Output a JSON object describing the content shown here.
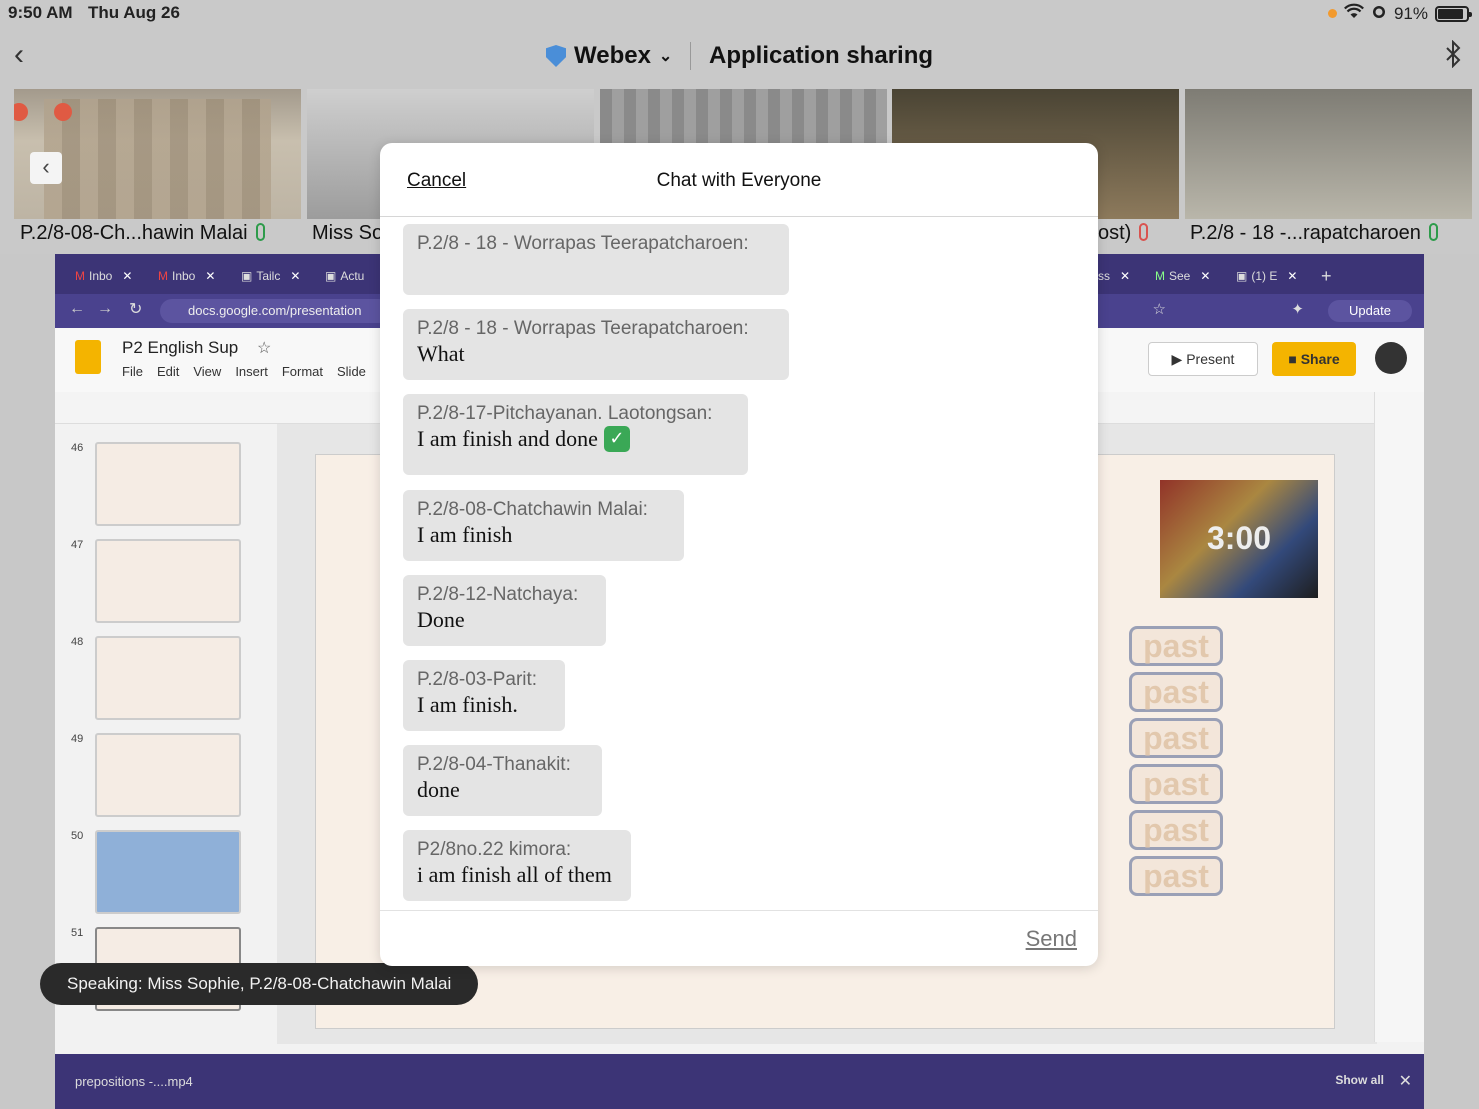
{
  "status_bar": {
    "time": "9:50 AM",
    "date": "Thu Aug 26",
    "battery": "91%",
    "battery_level": 0.91,
    "icons": [
      "wifi-icon",
      "alarm-icon",
      "battery-icon"
    ]
  },
  "header": {
    "back_icon": "chevron-left-icon",
    "app_name": "Webex",
    "mode": "Application sharing",
    "bluetooth_icon": "bluetooth-icon"
  },
  "participants": [
    {
      "name": "P.2/8-08-Ch...hawin Malai",
      "mic": "on"
    },
    {
      "name": "Miss So",
      "mic": "none"
    },
    {
      "name": "",
      "mic": "none"
    },
    {
      "name": "ost)",
      "mic": "muted"
    },
    {
      "name": "P.2/8 - 18 -...rapatcharoen",
      "mic": "on"
    }
  ],
  "browser": {
    "tabs": [
      {
        "label": "Inbo",
        "icon": "gmail-icon"
      },
      {
        "label": "Inbo",
        "icon": "gmail-icon"
      },
      {
        "label": "Tailc",
        "icon": "page-icon"
      },
      {
        "label": "Actu",
        "icon": "page-icon"
      },
      {
        "label": "ss",
        "icon": "page-icon"
      },
      {
        "label": "See",
        "icon": "gmail-icon"
      },
      {
        "label": "(1) E",
        "icon": "page-icon"
      }
    ],
    "new_tab": "+",
    "url": "docs.google.com/presentation",
    "update_label": "Update",
    "doc_title": "P2 English Sup",
    "menu": [
      "File",
      "Edit",
      "View",
      "Insert",
      "Format",
      "Slide"
    ],
    "present_label": "Present",
    "share_label": "Share",
    "thumbnails": [
      "46",
      "47",
      "48",
      "49",
      "50",
      "51"
    ],
    "video_label": "3:00",
    "past_words": [
      "past",
      "past",
      "past",
      "past",
      "past",
      "past"
    ],
    "download_file": "prepositions -....mp4",
    "show_all": "Show all"
  },
  "speaking": "Speaking: Miss Sophie, P.2/8-08-Chatchawin Malai",
  "chat": {
    "cancel": "Cancel",
    "title": "Chat with Everyone",
    "send": "Send",
    "messages": [
      {
        "sender": "P.2/8 - 18 - Worrapas Teerapatcharoen:",
        "text": ""
      },
      {
        "sender": "P.2/8 - 18 - Worrapas Teerapatcharoen:",
        "text": "What"
      },
      {
        "sender": "P.2/8-17-Pitchayanan. Laotongsan:",
        "text": "I am finish and done",
        "emoji": "✓"
      },
      {
        "sender": "P.2/8-08-Chatchawin Malai:",
        "text": "I am finish"
      },
      {
        "sender": "P.2/8-12-Natchaya:",
        "text": "Done"
      },
      {
        "sender": "P.2/8-03-Parit:",
        "text": "I am finish."
      },
      {
        "sender": "P.2/8-04-Thanakit:",
        "text": "done"
      },
      {
        "sender": "P2/8no.22 kimora:",
        "text": "i am finish all of them"
      }
    ]
  }
}
